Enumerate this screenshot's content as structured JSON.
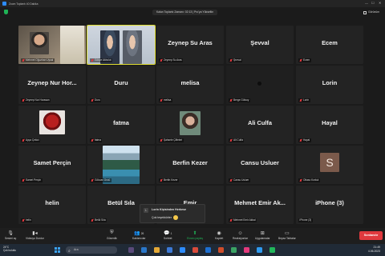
{
  "window": {
    "title": "Zoom Toplantı 40 Dakika",
    "controls": {
      "minimize": "—",
      "maximize": "☐",
      "close": "✕"
    }
  },
  "topbar": {
    "meeting_info": "Kalan Toplantı Zamanı: 02:13 | Pro'ya Yükseltin",
    "view_label": "Görünüm"
  },
  "tiles": [
    {
      "name": "",
      "label": "Mehmet Oğuzhan Uysal",
      "muted": true,
      "video": "person-hat"
    },
    {
      "name": "",
      "label": "Gökçe Akbulut",
      "muted": true,
      "video": "two-people",
      "active": true
    },
    {
      "name": "Zeynep Su Aras",
      "label": "Zeynep Su Aras",
      "muted": true
    },
    {
      "name": "Şevval",
      "label": "Şevval",
      "muted": true
    },
    {
      "name": "Ecem",
      "label": "Ecem",
      "muted": true
    },
    {
      "name": "Zeynep Nur Hor...",
      "label": "Zeynep Nur Horasan",
      "muted": true
    },
    {
      "name": "Duru",
      "label": "Duru",
      "muted": true
    },
    {
      "name": "melisa",
      "label": "melisa",
      "muted": true
    },
    {
      "name": "",
      "label": "Berge Gülsoy",
      "muted": true,
      "video": "dark-camera"
    },
    {
      "name": "Lorin",
      "label": "Lorin",
      "muted": true
    },
    {
      "name": "",
      "label": "Ayça Çekici",
      "muted": true,
      "video": "deadpool"
    },
    {
      "name": "fatma",
      "label": "fatma",
      "muted": true
    },
    {
      "name": "",
      "label": "Şahsele Çifteleri",
      "muted": true,
      "video": "selfie"
    },
    {
      "name": "Ali Culfa",
      "label": "Ali Culfa",
      "muted": true
    },
    {
      "name": "Hayal",
      "label": "Hayal",
      "muted": true
    },
    {
      "name": "Samet Perçin",
      "label": "Samet Perçin",
      "muted": true
    },
    {
      "name": "",
      "label": "Gökcan Üncü",
      "muted": true,
      "video": "lake"
    },
    {
      "name": "Berfin Kezer",
      "label": "Berfin Kezer",
      "muted": true
    },
    {
      "name": "Cansu Usluer",
      "label": "Cansu Usluer",
      "muted": true
    },
    {
      "name": "",
      "label": "Oltaso Korkut",
      "muted": true,
      "avatar": "S"
    },
    {
      "name": "helin",
      "label": "helin",
      "muted": true
    },
    {
      "name": "Betül Sıla",
      "label": "Betül Sıla",
      "muted": true
    },
    {
      "name": "Emir",
      "label": "Emir",
      "muted": true
    },
    {
      "name": "Mehmet Emir Ak...",
      "label": "Mehmet Emir Akbal",
      "muted": true
    },
    {
      "name": "iPhone (3)",
      "label": "iPhone (3)",
      "muted": false
    }
  ],
  "notification": {
    "title": "Lorin Kişisinden Herkese",
    "message": "Çok teşekkürler"
  },
  "toolbar": {
    "items": [
      {
        "label": "Sesimi aç",
        "icon": "microphone-icon"
      },
      {
        "label": "Videoyu Durdur",
        "icon": "video-camera-icon"
      },
      {
        "label": "Güvenlik",
        "icon": "shield-icon"
      },
      {
        "label": "Katılımcılar",
        "icon": "participants-icon",
        "count": "26"
      },
      {
        "label": "Sohbet",
        "icon": "chat-icon",
        "count": "1"
      },
      {
        "label": "Ekranı paylaş",
        "icon": "share-screen-icon"
      },
      {
        "label": "Kaydet",
        "icon": "record-icon"
      },
      {
        "label": "Reaksiyonlar",
        "icon": "reaction-icon"
      },
      {
        "label": "Uygulamalar",
        "icon": "apps-icon"
      },
      {
        "label": "Beyaz Tahtalar",
        "icon": "whiteboard-icon"
      }
    ],
    "end_label": "Sonlandır"
  },
  "taskbar": {
    "weather_temp": "24°C",
    "weather_desc": "Çok bulutlu",
    "search_placeholder": "Ara",
    "time": "21:49",
    "date": "4.06.2023"
  },
  "colors": {
    "active_speaker": "#dedc2f",
    "end_button": "#e0393e",
    "share_button": "#1fb356",
    "muted_icon": "#e0393e"
  }
}
